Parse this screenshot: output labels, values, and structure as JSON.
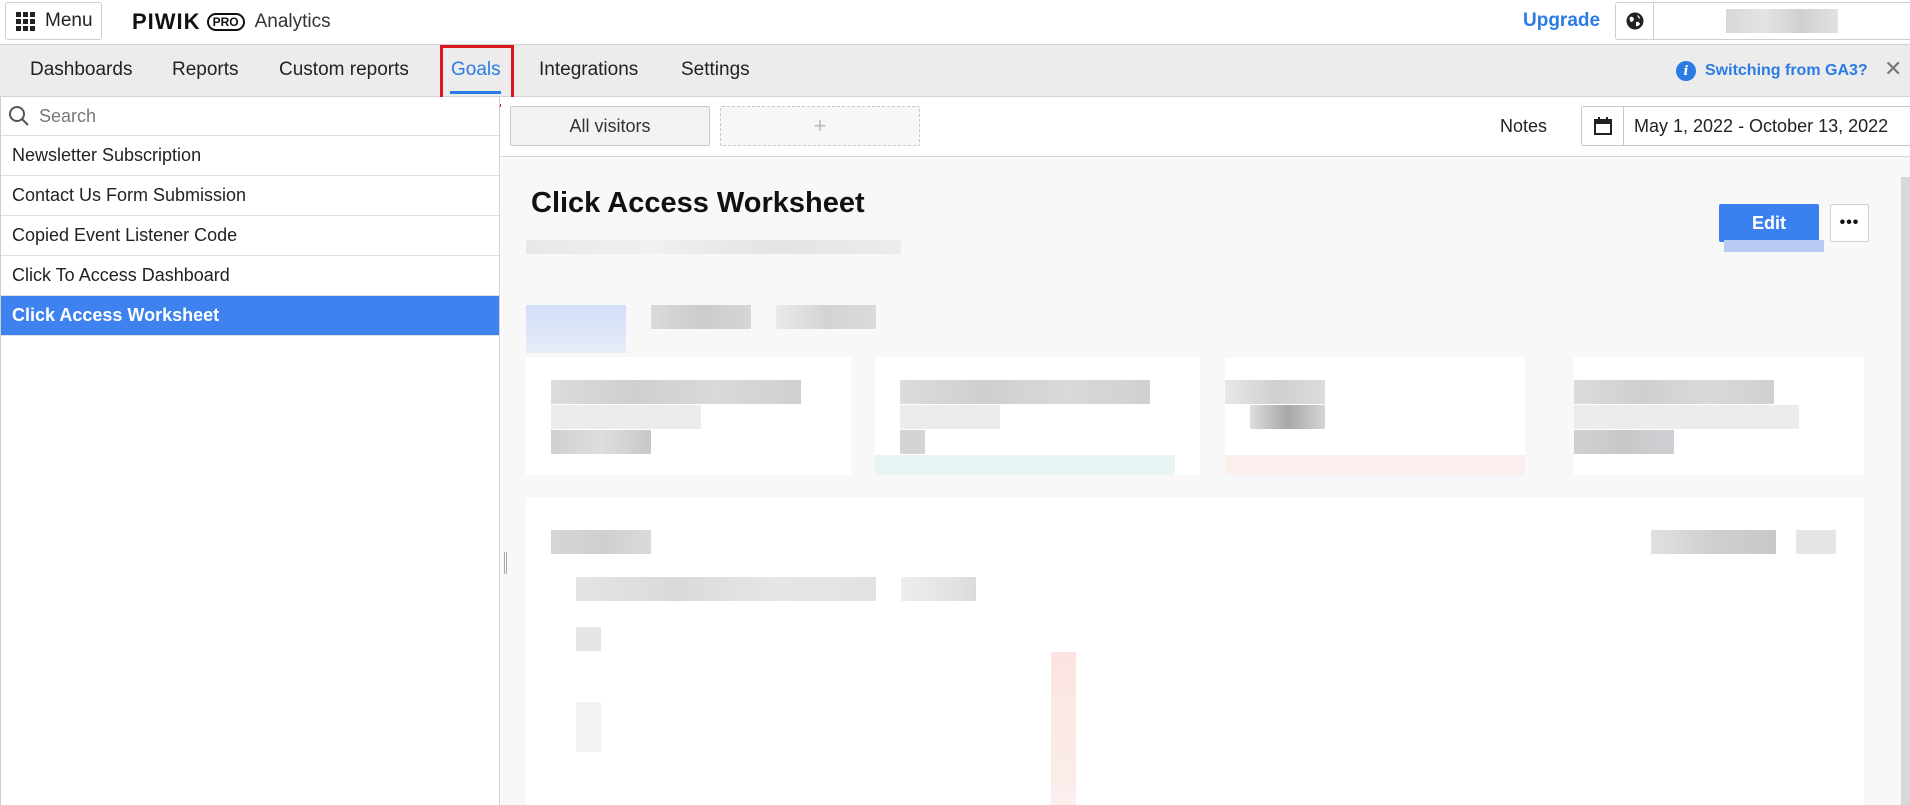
{
  "topbar": {
    "menu_label": "Menu",
    "logo_word": "PIWIK",
    "logo_pro": "PRO",
    "logo_analytics": "Analytics",
    "upgrade_label": "Upgrade"
  },
  "nav": {
    "items": [
      {
        "label": "Dashboards"
      },
      {
        "label": "Reports"
      },
      {
        "label": "Custom reports"
      },
      {
        "label": "Goals",
        "active": true
      },
      {
        "label": "Integrations"
      },
      {
        "label": "Settings"
      }
    ],
    "info_link": "Switching from GA3?",
    "info_icon": "i",
    "close_label": "✕"
  },
  "sidebar": {
    "search_placeholder": "Search",
    "goals": [
      {
        "label": "Newsletter Subscription"
      },
      {
        "label": "Contact Us Form Submission"
      },
      {
        "label": "Copied Event Listener Code"
      },
      {
        "label": "Click To Access Dashboard"
      },
      {
        "label": "Click Access Worksheet",
        "selected": true
      }
    ]
  },
  "toolbar": {
    "segment_label": "All visitors",
    "add_segment_label": "+",
    "notes_label": "Notes",
    "date_range": "May 1, 2022 - October 13, 2022"
  },
  "main": {
    "title": "Click Access Worksheet",
    "edit_label": "Edit",
    "more_label": "•••"
  },
  "colors": {
    "accent": "#2c7be5",
    "selected_bg": "#3d82ee",
    "highlight_box": "#d9181f"
  }
}
